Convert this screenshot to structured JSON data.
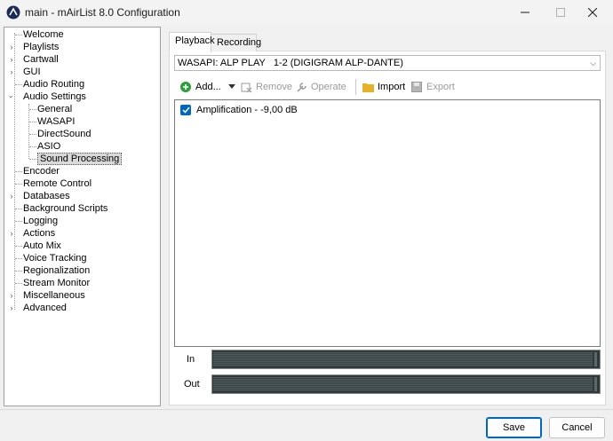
{
  "window": {
    "title": "main - mAirList 8.0 Configuration"
  },
  "tree": {
    "items": [
      {
        "label": "Welcome"
      },
      {
        "label": "Playlists"
      },
      {
        "label": "Cartwall"
      },
      {
        "label": "GUI"
      },
      {
        "label": "Audio Routing"
      },
      {
        "label": "Audio Settings"
      },
      {
        "label": "General"
      },
      {
        "label": "WASAPI"
      },
      {
        "label": "DirectSound"
      },
      {
        "label": "ASIO"
      },
      {
        "label": "Sound Processing"
      },
      {
        "label": "Encoder"
      },
      {
        "label": "Remote Control"
      },
      {
        "label": "Databases"
      },
      {
        "label": "Background Scripts"
      },
      {
        "label": "Logging"
      },
      {
        "label": "Actions"
      },
      {
        "label": "Auto Mix"
      },
      {
        "label": "Voice Tracking"
      },
      {
        "label": "Regionalization"
      },
      {
        "label": "Stream Monitor"
      },
      {
        "label": "Miscellaneous"
      },
      {
        "label": "Advanced"
      }
    ]
  },
  "tabs": [
    {
      "label": "Playback"
    },
    {
      "label": "Recording"
    }
  ],
  "device": {
    "selected": "WASAPI: ALP PLAY   1-2 (DIGIGRAM ALP-DANTE)"
  },
  "toolbar": {
    "add": "Add...",
    "remove": "Remove",
    "operate": "Operate",
    "import": "Import",
    "export": "Export"
  },
  "processors": [
    {
      "label": "Amplification - -9,00 dB",
      "checked": true
    }
  ],
  "meters": {
    "in_label": "In",
    "out_label": "Out"
  },
  "buttons": {
    "save": "Save",
    "cancel": "Cancel"
  },
  "colors": {
    "accent": "#0067c0",
    "add_icon": "#2e9e3e",
    "folder_icon": "#e8b12a"
  }
}
